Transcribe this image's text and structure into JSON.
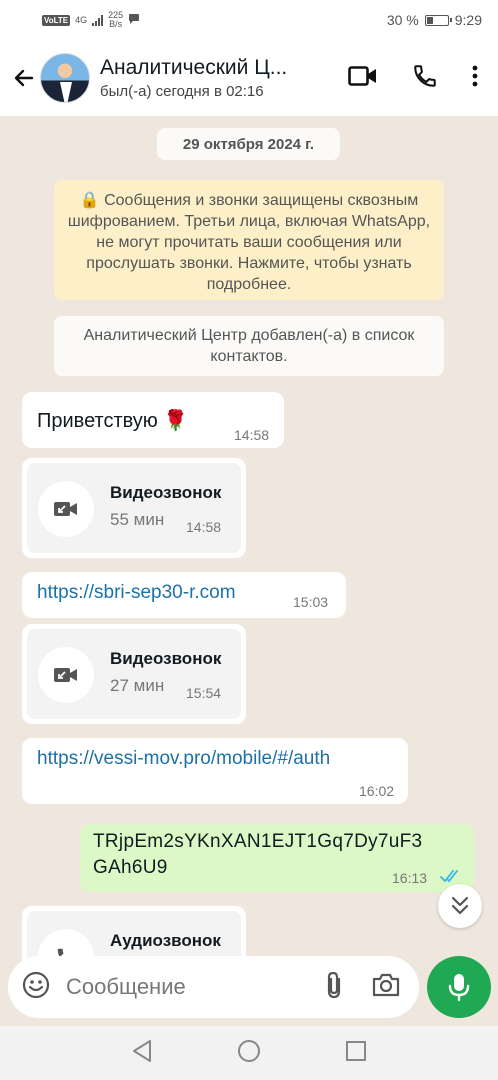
{
  "status_bar": {
    "volte": "VoLTE",
    "signal": "4G",
    "net_speed_value": "225",
    "net_speed_unit": "B/s",
    "battery_text": "30 %",
    "battery_level_percent": 30,
    "time": "9:29"
  },
  "header": {
    "title": "Аналитический Ц...",
    "subtitle": "был(-а) сегодня в 02:16"
  },
  "chat": {
    "date_chip": "29 октября 2024 г.",
    "encryption_notice": "🔒 Сообщения и звонки защищены сквозным шифрованием. Третьи лица, включая WhatsApp, не могут прочитать ваши сообщения или прослушать звонки. Нажмите, чтобы узнать подробнее.",
    "system_message": "Аналитический Центр добавлен(-а) в список контактов.",
    "messages": [
      {
        "text": "Приветствую 🌹",
        "time": "14:58"
      },
      {
        "title": "Видеозвонок",
        "duration": "55 мин",
        "time": "14:58"
      },
      {
        "text": "https://sbri-sep30-r.com",
        "time": "15:03"
      },
      {
        "title": "Видеозвонок",
        "duration": "27 мин",
        "time": "15:54"
      },
      {
        "text": "https://vessi-mov.pro/mobile/#/auth",
        "time": "16:02"
      },
      {
        "line1": "TRjpEm2sYKnXAN1EJT1Gq7Dy7uF3",
        "line2": "GAh6U9",
        "time": "16:13"
      },
      {
        "title": "Аудиозвонок"
      }
    ]
  },
  "input": {
    "placeholder": "Сообщение"
  },
  "colors": {
    "accent_green": "#1ea952",
    "outgoing_bubble": "#dcf8c6",
    "link": "#1b72a8",
    "read_ticks": "#34b7f1",
    "chat_bg": "#efe7dd"
  }
}
